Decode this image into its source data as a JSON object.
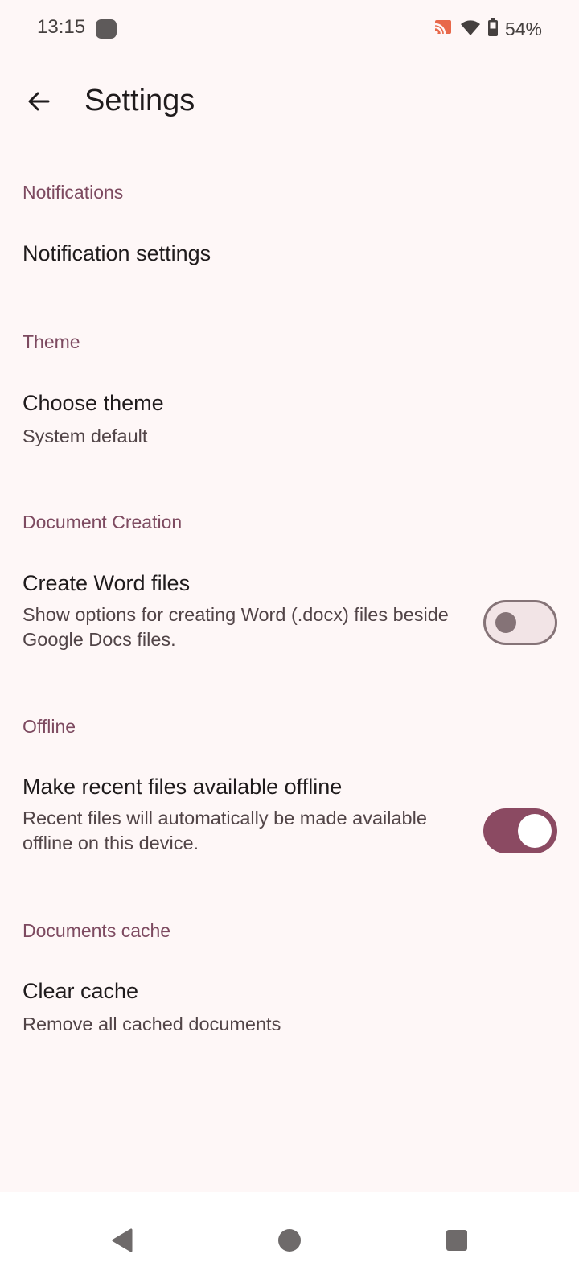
{
  "status_bar": {
    "time": "13:15",
    "battery_text": "54%",
    "icons": [
      "app-notification-icon",
      "cast-icon",
      "wifi-icon",
      "battery-icon"
    ],
    "cast_color": "#E8684A"
  },
  "app_bar": {
    "back_icon": "arrow-back-icon",
    "title": "Settings"
  },
  "sections": {
    "notifications": {
      "header": "Notifications",
      "item_title": "Notification settings"
    },
    "theme": {
      "header": "Theme",
      "item_title": "Choose theme",
      "item_subtitle": "System default"
    },
    "document_creation": {
      "header": "Document Creation",
      "item_title": "Create Word files",
      "item_subtitle": "Show options for creating Word (.docx) files beside Google Docs files.",
      "toggle_on": false
    },
    "offline": {
      "header": "Offline",
      "item_title": "Make recent files available offline",
      "item_subtitle": "Recent files will automatically be made available offline on this device.",
      "toggle_on": true
    },
    "documents_cache": {
      "header": "Documents cache",
      "item_title": "Clear cache",
      "item_subtitle": "Remove all cached documents"
    }
  },
  "nav_bar": {
    "icons": [
      "back-triangle-icon",
      "home-circle-icon",
      "recents-square-icon"
    ]
  },
  "colors": {
    "background": "#FEF7F7",
    "accent": "#7D4A60",
    "toggle_on": "#8B4A62",
    "toggle_off_track": "#F2E4E6",
    "toggle_off_outline": "#857377"
  }
}
